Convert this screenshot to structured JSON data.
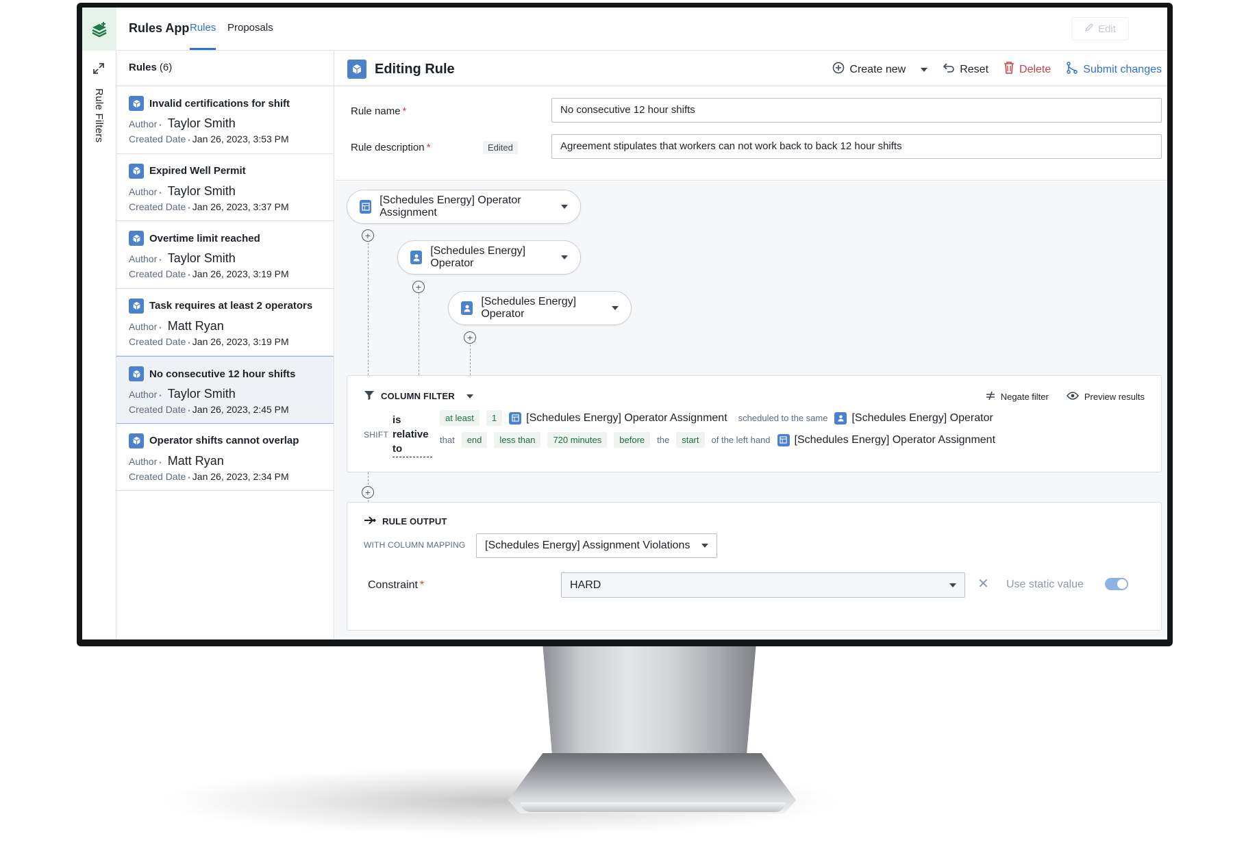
{
  "header": {
    "app_title": "Rules App",
    "tabs": [
      {
        "label": "Rules"
      },
      {
        "label": "Proposals"
      }
    ],
    "edit_label": "Edit"
  },
  "rail": {
    "label": "Rule Filters"
  },
  "rules_list": {
    "title": "Rules",
    "count": "(6)",
    "author_label": "Author",
    "date_label": "Created Date",
    "items": [
      {
        "title": "Invalid certifications for shift",
        "author": "Taylor Smith",
        "date": "Jan 26, 2023, 3:53 PM"
      },
      {
        "title": "Expired Well Permit",
        "author": "Taylor Smith",
        "date": "Jan 26, 2023, 3:37 PM"
      },
      {
        "title": "Overtime limit reached",
        "author": "Taylor Smith",
        "date": "Jan 26, 2023, 3:19 PM"
      },
      {
        "title": "Task requires at least 2 operators",
        "author": "Matt Ryan",
        "date": "Jan 26, 2023, 3:19 PM"
      },
      {
        "title": "No consecutive 12 hour shifts",
        "author": "Taylor Smith",
        "date": "Jan 26, 2023, 2:45 PM"
      },
      {
        "title": "Operator shifts cannot overlap",
        "author": "Matt Ryan",
        "date": "Jan 26, 2023, 2:34 PM"
      }
    ]
  },
  "editor": {
    "title": "Editing Rule",
    "toolbar": {
      "create_new": "Create new",
      "reset": "Reset",
      "delete": "Delete",
      "submit": "Submit changes"
    },
    "rule_name_label": "Rule name",
    "rule_name_value": "No consecutive 12 hour shifts",
    "rule_desc_label": "Rule description",
    "edited_tag": "Edited",
    "rule_desc_value": "Agreement stipulates that workers can not work back to back 12 hour shifts",
    "nodes": [
      {
        "label": "[Schedules Energy] Operator Assignment"
      },
      {
        "label": "[Schedules Energy] Operator"
      },
      {
        "label": "[Schedules Energy] Operator"
      }
    ],
    "column_filter": {
      "title": "COLUMN FILTER",
      "negate": "Negate filter",
      "preview": "Preview results",
      "shift_label": "SHIFT",
      "relation_words": [
        "is",
        "relative",
        "to"
      ],
      "line1": {
        "at_least": "at least",
        "count": "1",
        "entity_a": "[Schedules Energy] Operator Assignment",
        "scheduled": "scheduled to the same",
        "entity_b": "[Schedules Energy] Operator"
      },
      "line2": {
        "that": "that",
        "end": "end",
        "less_than": "less than",
        "minutes": "720 minutes",
        "before": "before",
        "the": "the",
        "start": "start",
        "of_left": "of the left hand",
        "entity_c": "[Schedules Energy] Operator Assignment"
      }
    },
    "rule_output": {
      "title": "RULE OUTPUT",
      "mapping_label": "WITH COLUMN MAPPING",
      "mapping_value": "[Schedules Energy] Assignment Violations",
      "constraint_label": "Constraint",
      "constraint_value": "HARD",
      "static_label": "Use static value",
      "static_on": true
    }
  },
  "colors": {
    "accent": "#2d72d2",
    "danger": "#cd4246",
    "chip_text": "#1c6e42",
    "entity_icon": "#4c82cc"
  }
}
